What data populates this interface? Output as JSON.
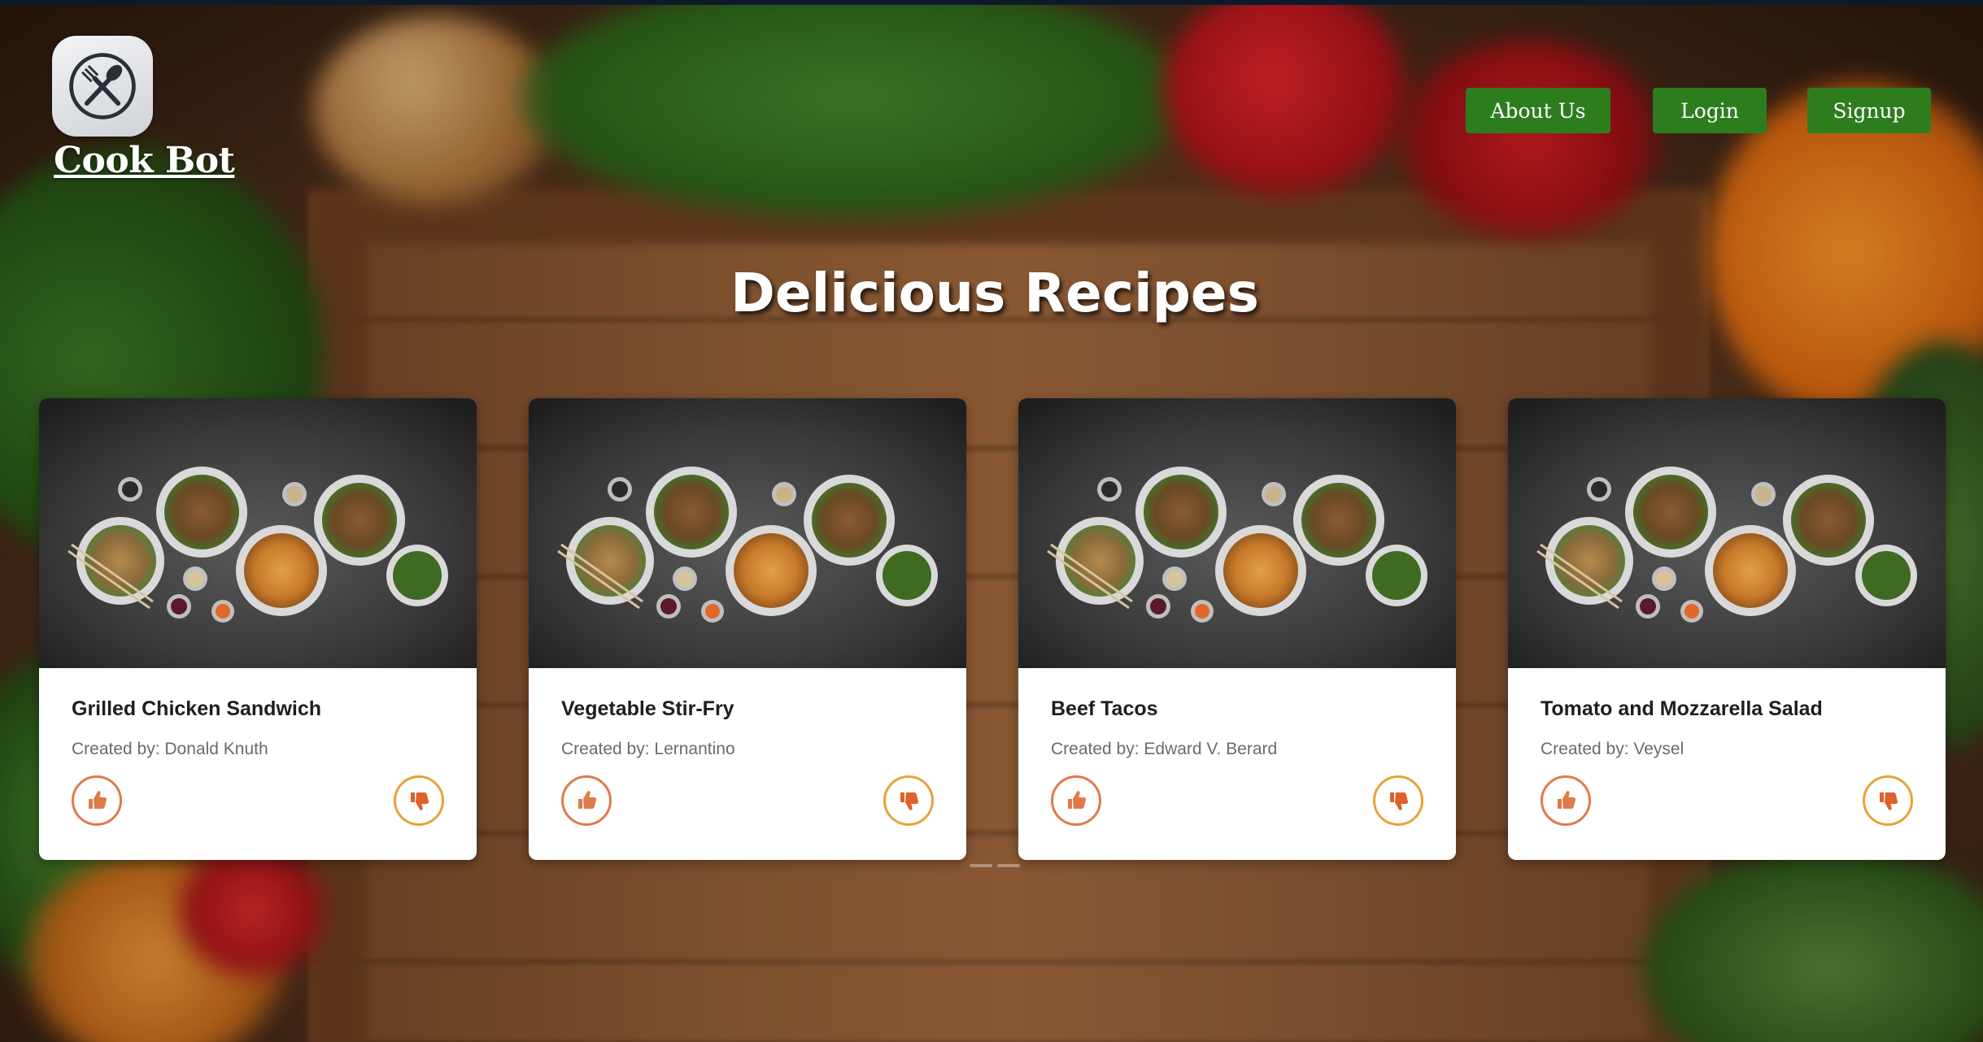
{
  "header": {
    "brand": "Cook Bot",
    "nav": {
      "about": "About Us",
      "login": "Login",
      "signup": "Signup"
    }
  },
  "page": {
    "title": "Delicious Recipes"
  },
  "recipes": [
    {
      "title": "Grilled Chicken Sandwich",
      "author": "Created by: Donald Knuth"
    },
    {
      "title": "Vegetable Stir-Fry",
      "author": "Created by: Lernantino"
    },
    {
      "title": "Beef Tacos",
      "author": "Created by: Edward V. Berard"
    },
    {
      "title": "Tomato and Mozzarella Salad",
      "author": "Created by: Veysel"
    }
  ],
  "icons": {
    "logo": "fork-spoon-cross-icon",
    "like": "thumbs-up-icon",
    "dislike": "thumbs-down-icon"
  },
  "colors": {
    "nav_button": "#2d7d1e",
    "like_ring": "#e07a48",
    "dislike_ring": "#e8a23a"
  }
}
